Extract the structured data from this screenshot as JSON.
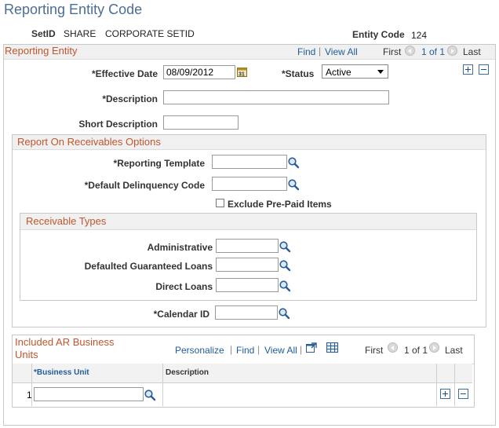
{
  "page": {
    "title": "Reporting Entity Code",
    "setid_label": "SetID",
    "setid_value": "SHARE",
    "setid_desc": "CORPORATE SETID",
    "entity_label": "Entity Code",
    "entity_value": "124"
  },
  "reporting_entity": {
    "header": "Reporting Entity",
    "find": "Find",
    "view_all": "View All",
    "first": "First",
    "page_count": "1 of 1",
    "last": "Last",
    "effective_date_label": "*Effective Date",
    "effective_date_value": "08/09/2012",
    "status_label": "*Status",
    "status_value": "Active",
    "description_label": "*Description",
    "description_value": "",
    "short_description_label": "Short Description",
    "short_description_value": ""
  },
  "receivables_options": {
    "header": "Report On Receivables Options",
    "reporting_template_label": "*Reporting Template",
    "reporting_template_value": "",
    "delinquency_label": "*Default Delinquency Code",
    "delinquency_value": "",
    "exclude_prepaid_label": "Exclude Pre-Paid Items",
    "receivable_types_header": "Receivable Types",
    "administrative_label": "Administrative",
    "administrative_value": "",
    "defaulted_label": "Defaulted Guaranteed Loans",
    "defaulted_value": "",
    "direct_label": "Direct Loans",
    "direct_value": "",
    "calendar_label": "*Calendar ID",
    "calendar_value": ""
  },
  "business_units": {
    "header_line1": "Included AR Business",
    "header_line2": "Units",
    "personalize": "Personalize",
    "find": "Find",
    "view_all": "View All",
    "first": "First",
    "page_count": "1 of 1",
    "last": "Last",
    "col_business_unit": "*Business Unit",
    "col_description": "Description",
    "rows": [
      {
        "num": "1",
        "business_unit": "",
        "description": ""
      }
    ]
  }
}
